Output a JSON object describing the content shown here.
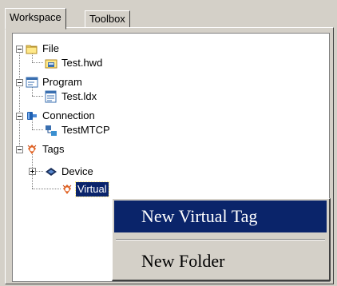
{
  "tabs": [
    {
      "label": "Workspace",
      "active": true
    },
    {
      "label": "Toolbox",
      "active": false
    }
  ],
  "tree": {
    "nodes": [
      {
        "label": "File",
        "icon": "folder-icon"
      },
      {
        "label": "Test.hwd",
        "icon": "hwd-file-icon"
      },
      {
        "label": "Program",
        "icon": "program-icon"
      },
      {
        "label": "Test.ldx",
        "icon": "ldx-file-icon"
      },
      {
        "label": "Connection",
        "icon": "connection-icon"
      },
      {
        "label": "TestMTCP",
        "icon": "network-node-icon"
      },
      {
        "label": "Tags",
        "icon": "tags-icon"
      },
      {
        "label": "Device",
        "icon": "device-icon"
      },
      {
        "label": "Virtual",
        "icon": "virtual-tag-icon",
        "selected": true
      }
    ]
  },
  "context_menu": {
    "items": [
      {
        "label": "New Virtual Tag",
        "highlighted": true
      },
      {
        "label": "New Folder",
        "highlighted": false
      }
    ]
  },
  "colors": {
    "face": "#d4d0c8",
    "selection": "#0a246a",
    "highlight_text": "#ffffff"
  }
}
